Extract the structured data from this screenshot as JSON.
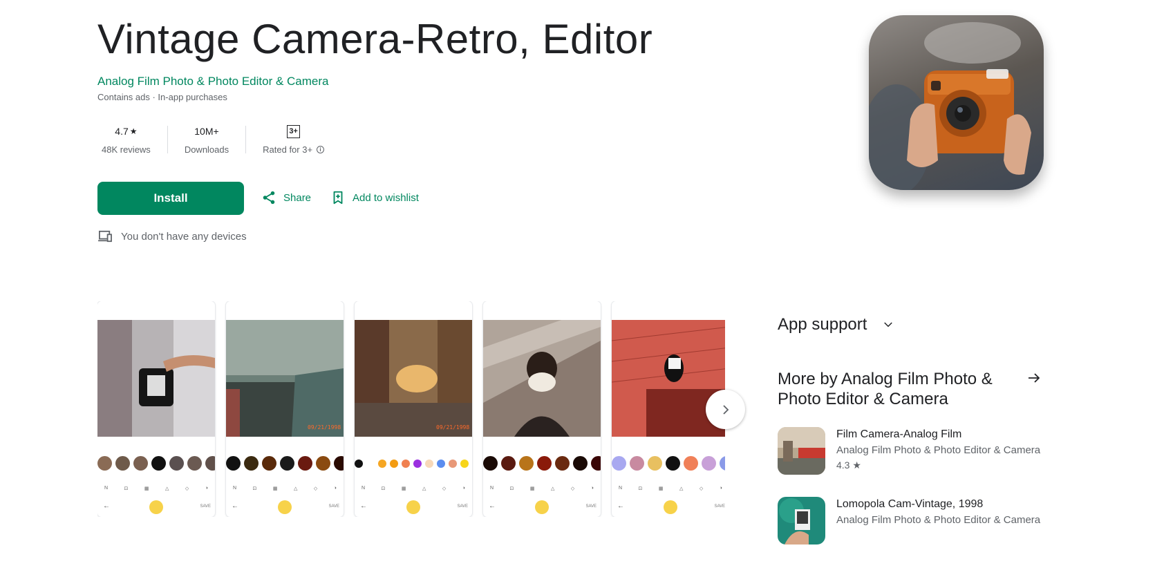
{
  "app": {
    "title": "Vintage Camera-Retro, Editor",
    "developer": "Analog Film Photo & Photo Editor & Camera",
    "subinfo": "Contains ads · In-app purchases"
  },
  "stats": {
    "rating": "4.7",
    "reviews": "48K reviews",
    "downloads": "10M+",
    "downloads_label": "Downloads",
    "content_rating": "3+",
    "content_rating_label": "Rated for 3+"
  },
  "actions": {
    "install": "Install",
    "share": "Share",
    "wishlist": "Add to wishlist"
  },
  "devices_note": "You don't have any devices",
  "screenshots": [
    {
      "date": ""
    },
    {
      "date": "09/21/1998"
    },
    {
      "date": "09/21/1998"
    },
    {
      "date": ""
    },
    {
      "date": ""
    }
  ],
  "sidebar": {
    "app_support": "App support",
    "more_by": "More by Analog Film Photo & Photo Editor & Camera",
    "related": [
      {
        "name": "Film Camera-Analog Film",
        "developer": "Analog Film Photo & Photo Editor & Camera",
        "rating": "4.3"
      },
      {
        "name": "Lomopola Cam-Vintage, 1998",
        "developer": "Analog Film Photo & Photo Editor & Camera",
        "rating": ""
      }
    ]
  },
  "colors": {
    "brand_green": "#01875f",
    "text_primary": "#202124",
    "text_secondary": "#5f6368"
  }
}
